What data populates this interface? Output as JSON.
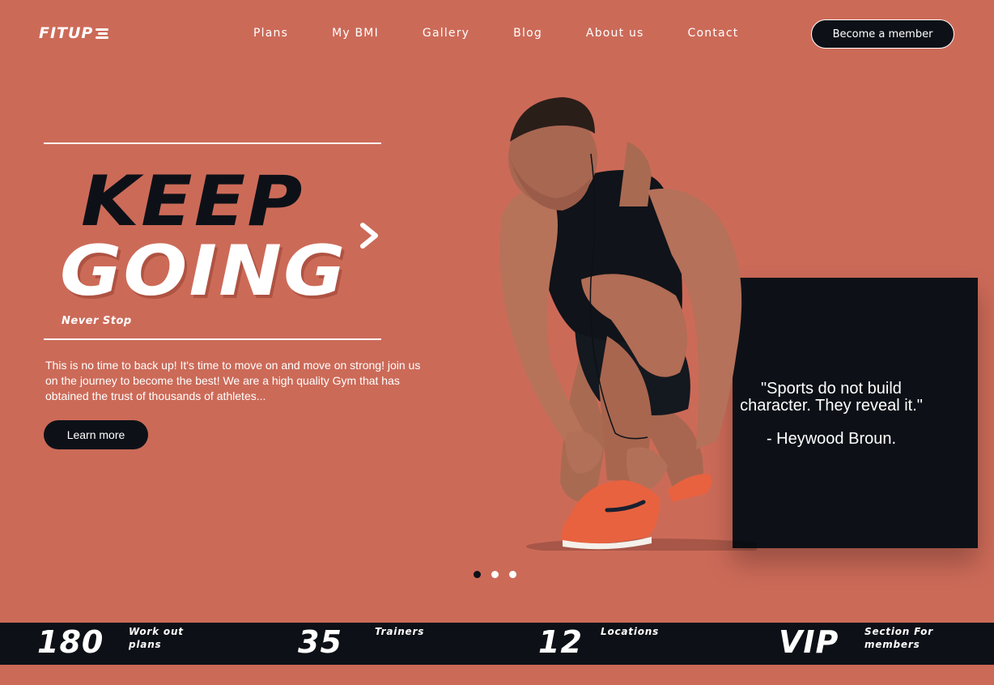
{
  "brand": {
    "logo_text": "FITUP"
  },
  "nav": {
    "items": [
      "Plans",
      "My BMI",
      "Gallery",
      "Blog",
      "About us",
      "Contact"
    ],
    "cta_label": "Become a member"
  },
  "hero": {
    "headline_line1": "KEEP",
    "headline_line2": "GOING",
    "tagline": "Never Stop",
    "body": "This is no time to back up! It's time to move on and move on strong! join us on the journey to become the best! We are a high quality Gym that has obtained the trust of thousands of athletes...",
    "button_label": "Learn more"
  },
  "quote": {
    "text": "\"Sports do not build character. They reveal it.\"",
    "author": "- Heywood Broun."
  },
  "carousel": {
    "count": 3,
    "active_index": 0
  },
  "stats": [
    {
      "number": "180",
      "label": "Work out\nplans"
    },
    {
      "number": "35",
      "label": "Trainers"
    },
    {
      "number": "12",
      "label": "Locations"
    },
    {
      "number": "VIP",
      "label": "Section For\nmembers"
    }
  ],
  "colors": {
    "background": "#cc6a58",
    "dark": "#0d1117",
    "accent_shoe": "#e8623f",
    "text": "#ffffff"
  }
}
